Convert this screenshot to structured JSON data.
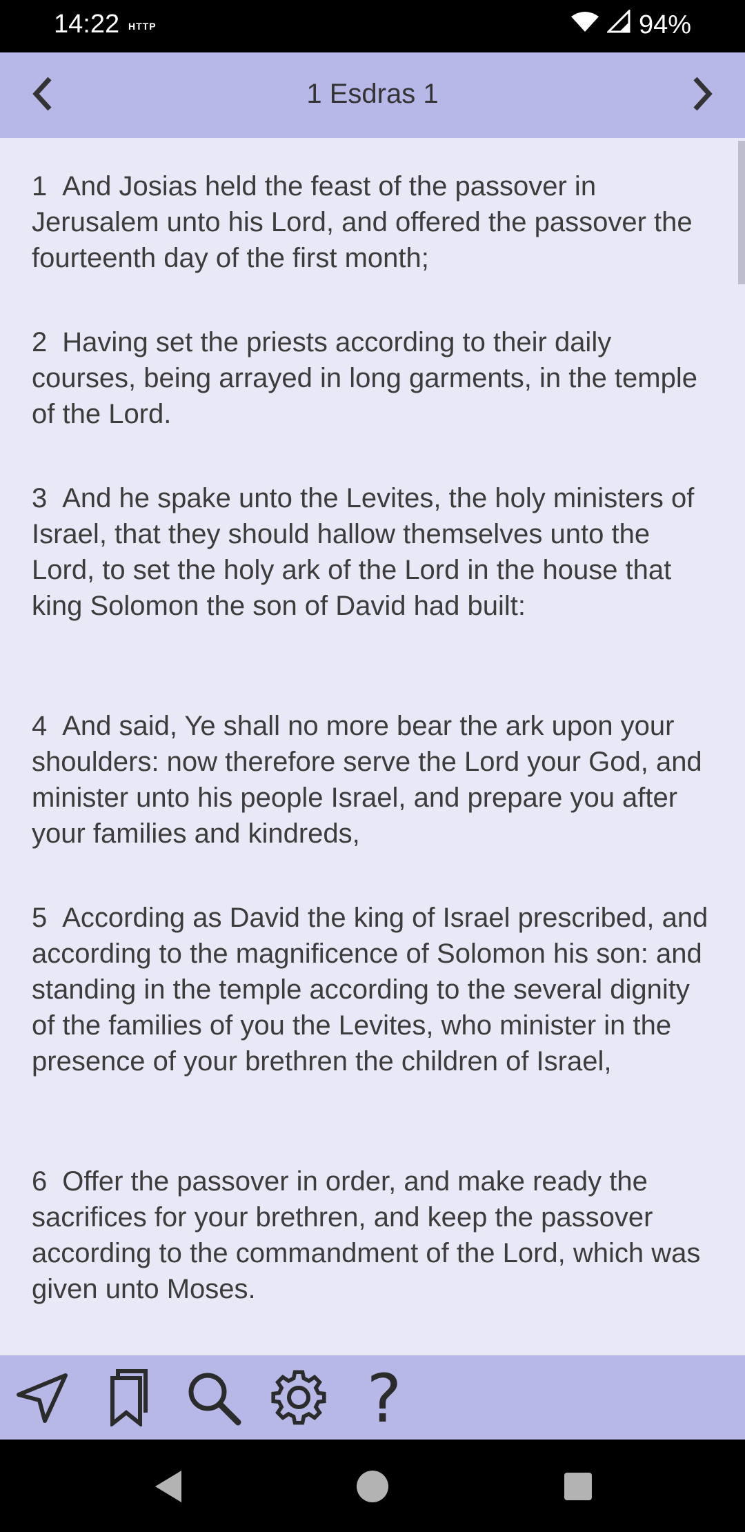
{
  "status": {
    "time": "14:22",
    "http_label": "HTTP",
    "battery": "94%"
  },
  "header": {
    "title": "1 Esdras 1",
    "prev_icon": "chevron-left-icon",
    "next_icon": "chevron-right-icon"
  },
  "verses": [
    {
      "num": "1",
      "text": "And Josias held the feast of the passover in Jerusalem unto his Lord, and offered the passover the fourteenth day of the first month;"
    },
    {
      "num": "2",
      "text": "Having set the priests according to their daily courses, being arrayed in long garments, in the temple of the Lord."
    },
    {
      "num": "3",
      "text": "And he spake unto the Levites, the holy ministers of Israel, that they should hallow themselves unto the Lord, to set the holy ark of the Lord in the house that king Solomon the son of David had built:"
    },
    {
      "num": "4",
      "text": "And said, Ye shall no more bear the ark upon your shoulders: now therefore serve the Lord your God, and minister unto his people Israel, and prepare you after your families and kindreds,"
    },
    {
      "num": "5",
      "text": "According as David the king of Israel prescribed, and according to the magnificence of Solomon his son: and standing in the temple according to the several dignity of the families of you the Levites, who minister in the presence of your brethren the children of Israel,"
    },
    {
      "num": "6",
      "text": "Offer the passover in order, and make ready the sacrifices for your brethren, and keep the passover according to the commandment of the Lord, which was given unto Moses."
    }
  ],
  "toolbar": {
    "icons": [
      "navigate-icon",
      "bookmarks-icon",
      "search-icon",
      "settings-icon",
      "help-icon"
    ],
    "help_glyph": "?"
  },
  "colors": {
    "app_bar": "#b8b8e8",
    "background": "#e8e8f6",
    "text": "#3c3c3c"
  }
}
